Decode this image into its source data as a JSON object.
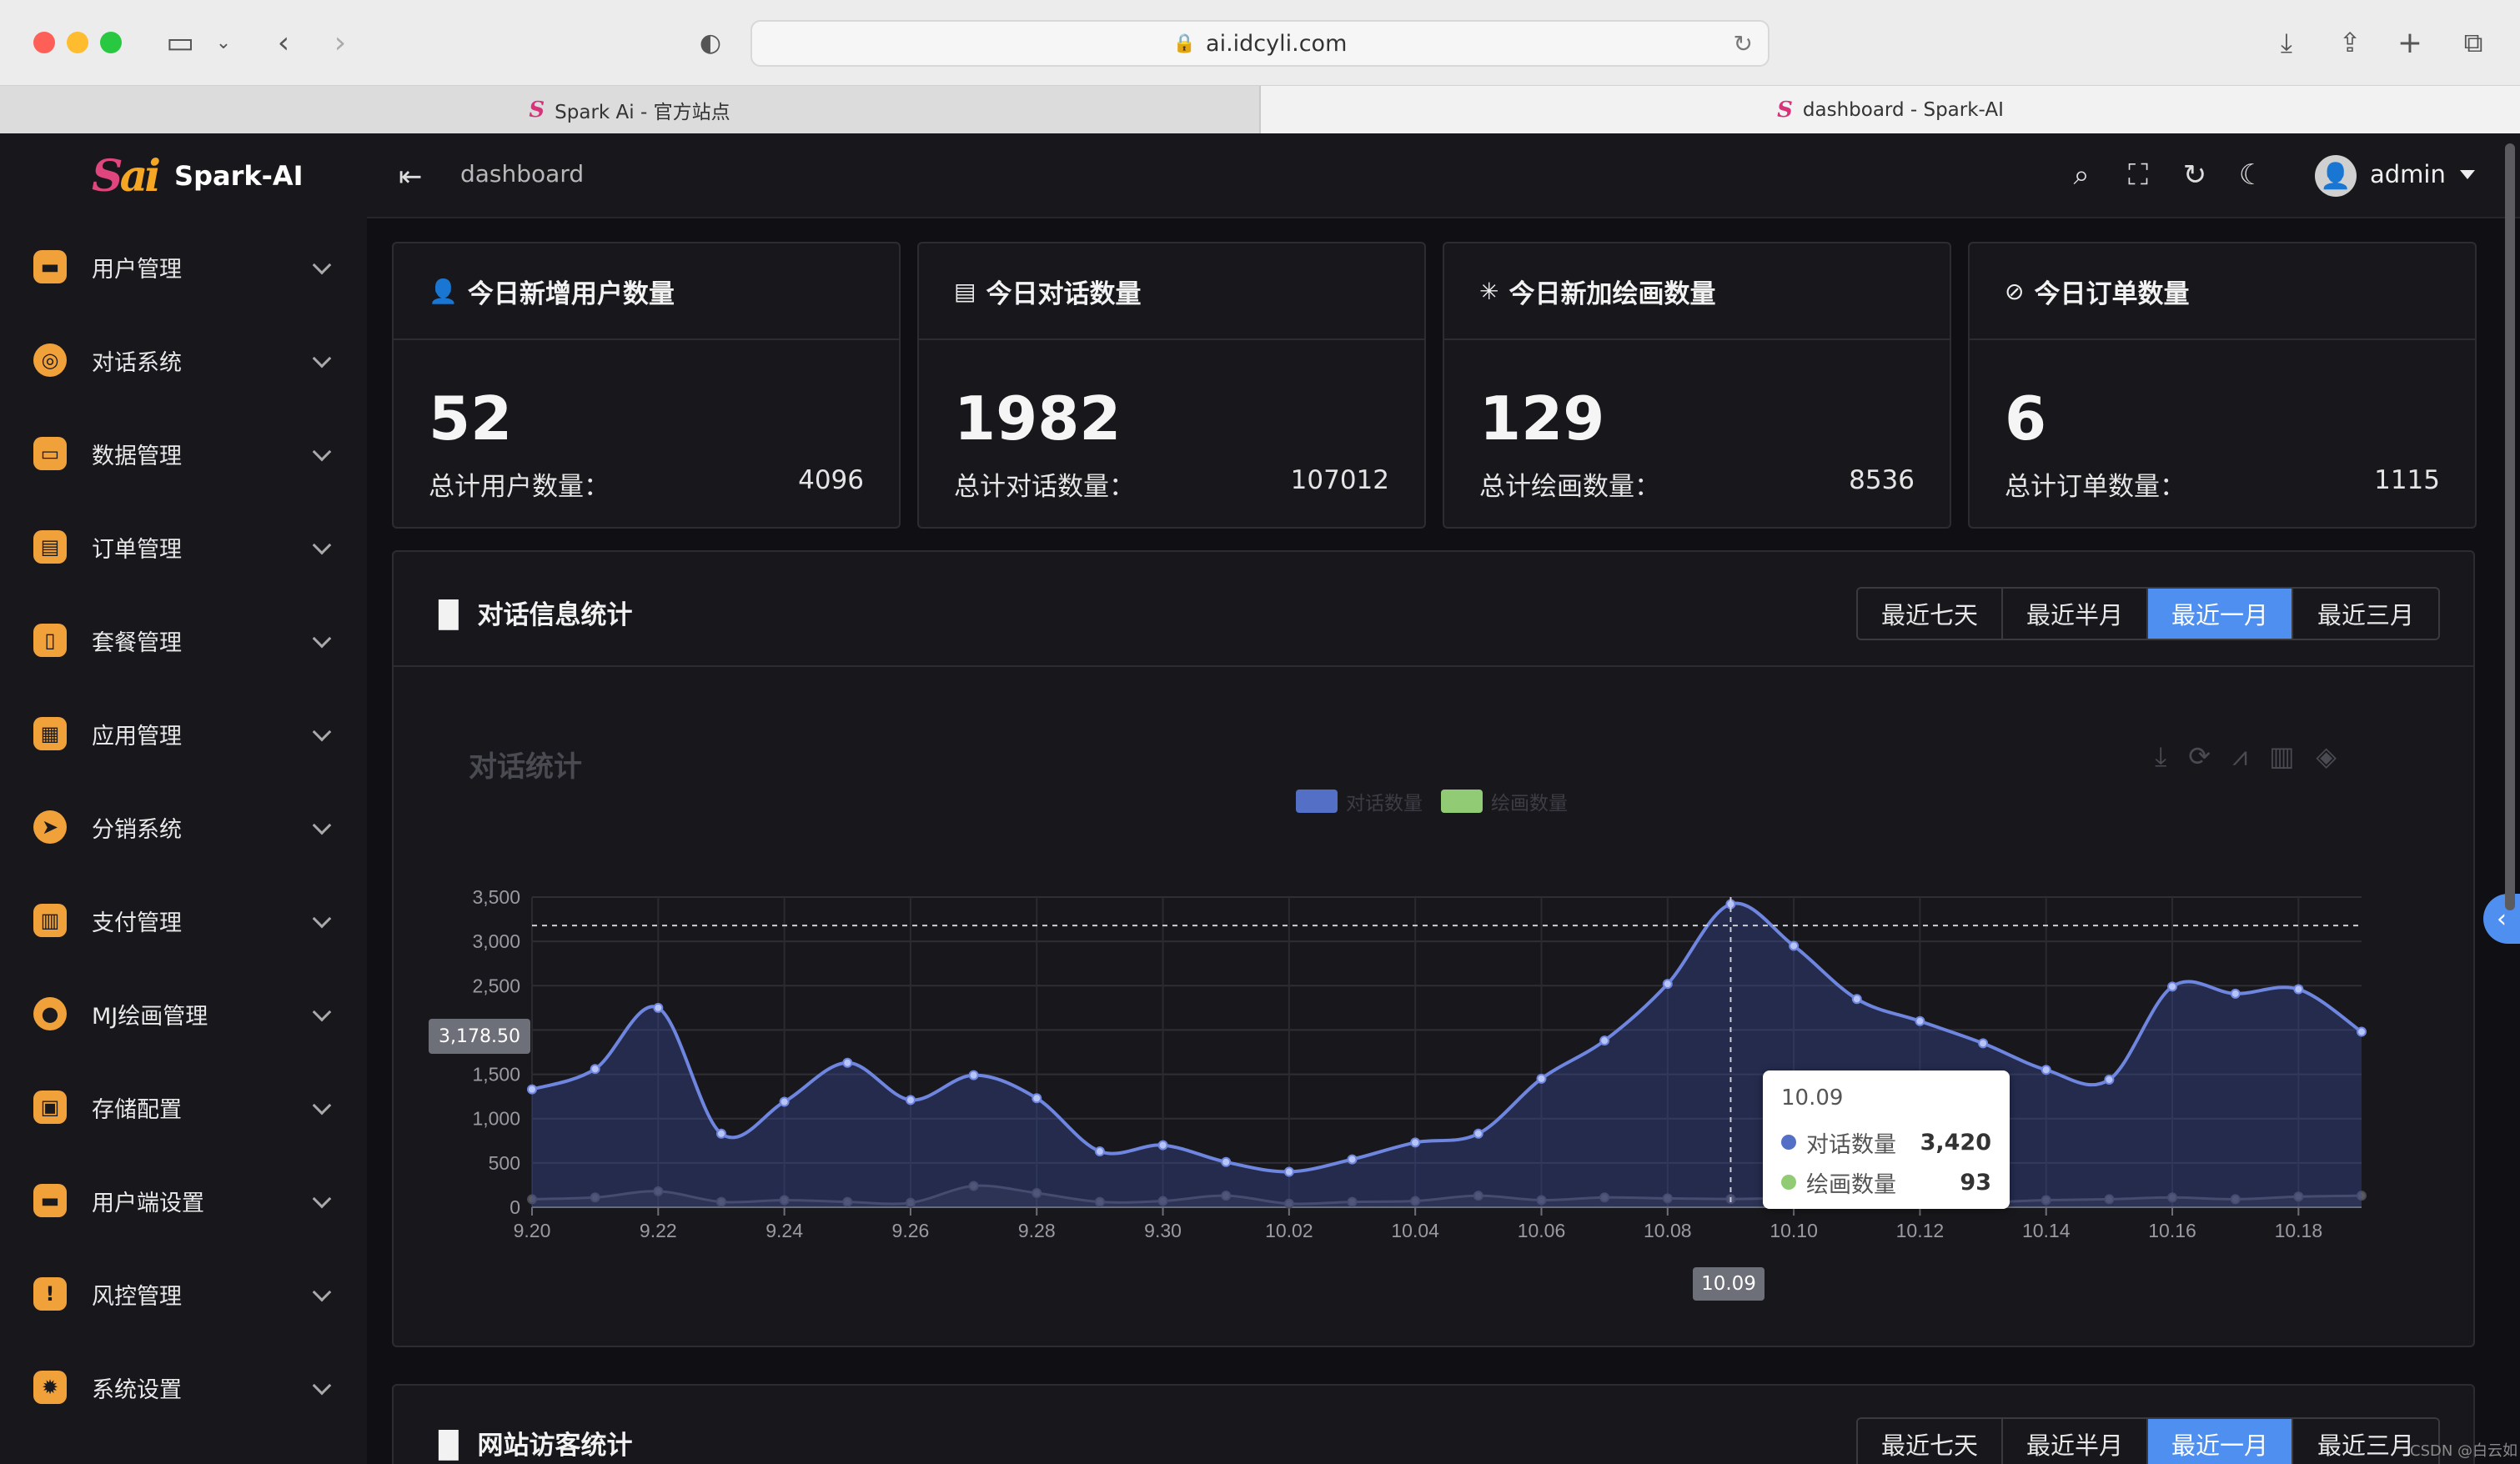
{
  "browser": {
    "url": "ai.idcyli.com",
    "tabs": [
      {
        "title": "Spark Ai - 官方站点",
        "active": false
      },
      {
        "title": "dashboard - Spark-AI",
        "active": true
      }
    ]
  },
  "app": {
    "brand": "Spark-AI",
    "breadcrumb": "dashboard",
    "user": "admin"
  },
  "sidebar": {
    "items": [
      {
        "label": "用户管理",
        "icon": "user-card-icon"
      },
      {
        "label": "对话系统",
        "icon": "chat-system-icon"
      },
      {
        "label": "数据管理",
        "icon": "data-icon"
      },
      {
        "label": "订单管理",
        "icon": "order-icon"
      },
      {
        "label": "套餐管理",
        "icon": "package-icon"
      },
      {
        "label": "应用管理",
        "icon": "apps-icon"
      },
      {
        "label": "分销系统",
        "icon": "distribution-icon"
      },
      {
        "label": "支付管理",
        "icon": "payment-icon"
      },
      {
        "label": "MJ绘画管理",
        "icon": "palette-icon"
      },
      {
        "label": "存储配置",
        "icon": "storage-icon"
      },
      {
        "label": "用户端设置",
        "icon": "client-settings-icon"
      },
      {
        "label": "风控管理",
        "icon": "shield-icon"
      },
      {
        "label": "系统设置",
        "icon": "gear-icon"
      }
    ]
  },
  "stats": [
    {
      "title": "今日新增用户数量",
      "value": "52",
      "sub": "总计用户数量：",
      "total": "4096"
    },
    {
      "title": "今日对话数量",
      "value": "1982",
      "sub": "总计对话数量：",
      "total": "107012"
    },
    {
      "title": "今日新加绘画数量",
      "value": "129",
      "sub": "总计绘画数量：",
      "total": "8536"
    },
    {
      "title": "今日订单数量",
      "value": "6",
      "sub": "总计订单数量：",
      "total": "1115"
    }
  ],
  "panel": {
    "title": "对话信息统计",
    "ranges": [
      "最近七天",
      "最近半月",
      "最近一月",
      "最近三月"
    ],
    "active_range": 2
  },
  "panel2": {
    "title": "网站访客统计",
    "ranges": [
      "最近七天",
      "最近半月",
      "最近一月",
      "最近三月"
    ],
    "active_range": 2
  },
  "chart_data": {
    "type": "area",
    "title": "对话统计",
    "legend_position": "top-center",
    "grid": true,
    "x": [
      "9.20",
      "9.21",
      "9.22",
      "9.23",
      "9.24",
      "9.25",
      "9.26",
      "9.27",
      "9.28",
      "9.29",
      "9.30",
      "10.01",
      "10.02",
      "10.03",
      "10.04",
      "10.05",
      "10.06",
      "10.07",
      "10.08",
      "10.09",
      "10.10",
      "10.11",
      "10.12",
      "10.13",
      "10.14",
      "10.15",
      "10.16",
      "10.17",
      "10.18",
      "10.19"
    ],
    "x_tick_labels": [
      "9.20",
      "9.22",
      "9.24",
      "9.26",
      "9.28",
      "9.30",
      "10.02",
      "10.04",
      "10.06",
      "10.08",
      "10.10",
      "10.12",
      "10.14",
      "10.16",
      "10.18"
    ],
    "ylim": [
      0,
      3500
    ],
    "y_ticks": [
      "0",
      "500",
      "1,000",
      "1,500",
      "2,000",
      "2,500",
      "3,000",
      "3,500"
    ],
    "series": [
      {
        "name": "对话数量",
        "color": "#5470c6",
        "values": [
          1330,
          1560,
          2250,
          830,
          1190,
          1630,
          1210,
          1490,
          1230,
          630,
          700,
          510,
          400,
          540,
          730,
          830,
          1450,
          1880,
          2520,
          3420,
          2950,
          2350,
          2100,
          1850,
          1550,
          1440,
          2490,
          2410,
          2460,
          1980
        ]
      },
      {
        "name": "绘画数量",
        "color": "#91cc75",
        "values": [
          90,
          110,
          180,
          60,
          80,
          60,
          50,
          240,
          160,
          60,
          70,
          130,
          40,
          60,
          70,
          130,
          80,
          110,
          100,
          93,
          100,
          70,
          110,
          60,
          80,
          90,
          110,
          90,
          120,
          130
        ]
      }
    ],
    "tooltip": {
      "category": "10.09",
      "rows": [
        {
          "name": "对话数量",
          "value": "3,420"
        },
        {
          "name": "绘画数量",
          "value": "93"
        }
      ]
    },
    "pointer": {
      "y_label": "3,178.50",
      "x_label": "10.09"
    }
  },
  "watermark": "CSDN @白云如幻"
}
